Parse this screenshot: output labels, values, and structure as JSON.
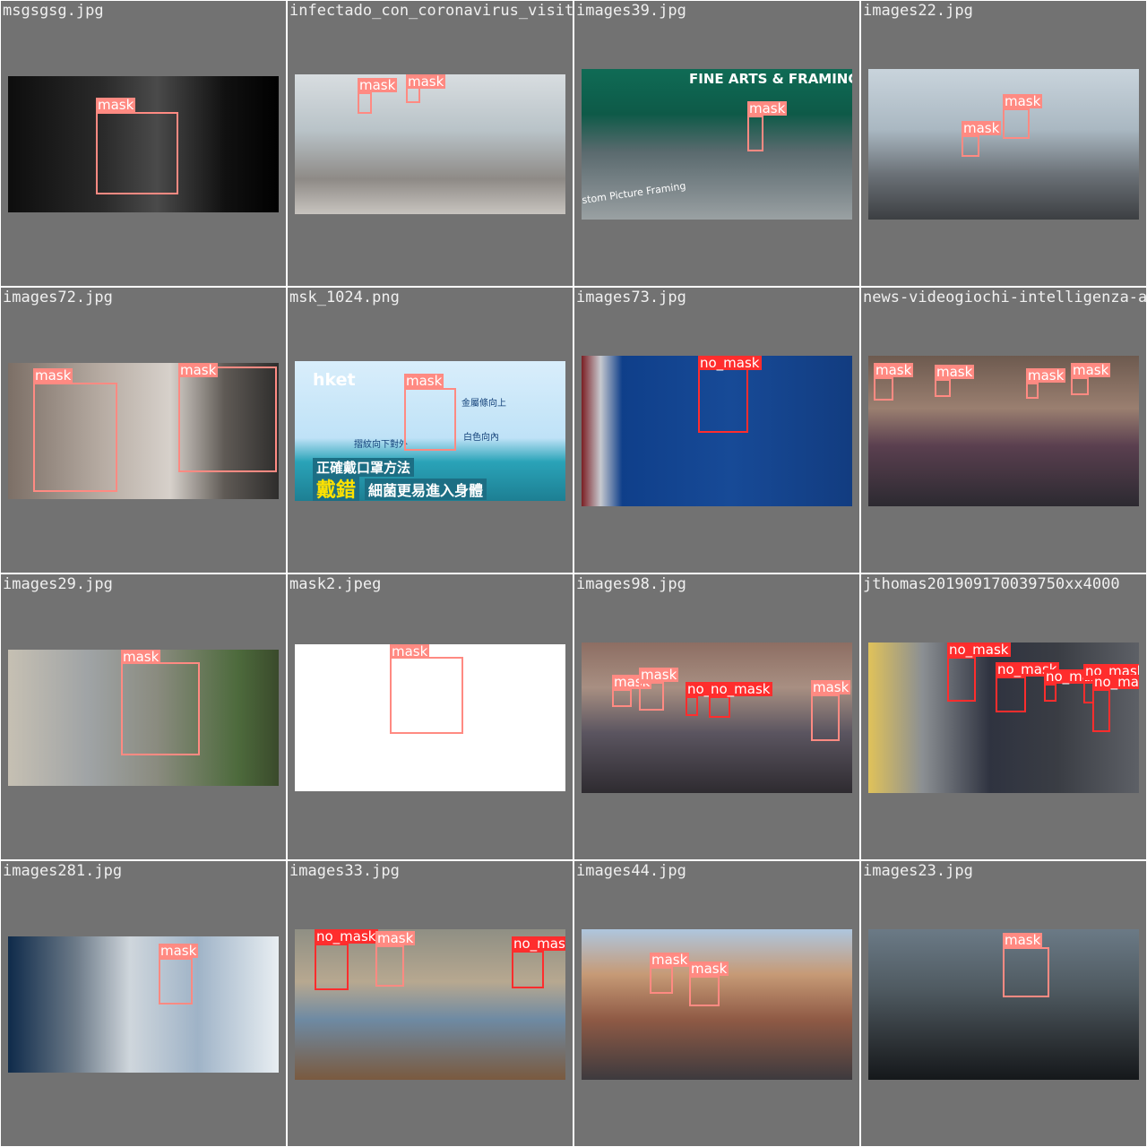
{
  "colors": {
    "mask": "#ff8a82",
    "no_mask": "#ff2d2d",
    "tile_bg": "#727272",
    "grid": "#ffffff"
  },
  "tiles": [
    {
      "title": "msgsgsg.jpg",
      "scene_texts": [],
      "detections": [
        {
          "label": "mask",
          "class": "mask"
        }
      ]
    },
    {
      "title": "infectado_con_coronavirus_visito_l",
      "scene_texts": [],
      "detections": [
        {
          "label": "mask",
          "class": "mask"
        },
        {
          "label": "mask",
          "class": "mask"
        }
      ]
    },
    {
      "title": "images39.jpg",
      "scene_texts": [
        "FINE ARTS & FRAMING",
        "stom Picture Framing"
      ],
      "detections": [
        {
          "label": "mask",
          "class": "mask"
        }
      ]
    },
    {
      "title": "images22.jpg",
      "scene_texts": [],
      "detections": [
        {
          "label": "mask",
          "class": "mask"
        },
        {
          "label": "mask",
          "class": "mask"
        }
      ]
    },
    {
      "title": "images72.jpg",
      "scene_texts": [],
      "detections": [
        {
          "label": "mask",
          "class": "mask"
        },
        {
          "label": "mask",
          "class": "mask"
        }
      ]
    },
    {
      "title": "msk_1024.png",
      "scene_texts": [
        "hket",
        "金屬條向上",
        "白色向內",
        "摺紋向下對外",
        "正確戴口罩方法",
        "戴錯",
        "細菌更易進入身體"
      ],
      "detections": [
        {
          "label": "mask",
          "class": "mask"
        }
      ]
    },
    {
      "title": "images73.jpg",
      "scene_texts": [],
      "detections": [
        {
          "label": "no_mask",
          "class": "no_mask"
        }
      ]
    },
    {
      "title": "news-videogiochi-intelligenza-art",
      "scene_texts": [],
      "detections": [
        {
          "label": "mask",
          "class": "mask"
        },
        {
          "label": "mask",
          "class": "mask"
        },
        {
          "label": "mask",
          "class": "mask"
        },
        {
          "label": "mask",
          "class": "mask"
        }
      ]
    },
    {
      "title": "images29.jpg",
      "scene_texts": [],
      "detections": [
        {
          "label": "mask",
          "class": "mask"
        }
      ]
    },
    {
      "title": "mask2.jpeg",
      "scene_texts": [],
      "detections": [
        {
          "label": "mask",
          "class": "mask"
        }
      ]
    },
    {
      "title": "images98.jpg",
      "scene_texts": [],
      "detections": [
        {
          "label": "mask",
          "class": "mask"
        },
        {
          "label": "mask",
          "class": "mask"
        },
        {
          "label": "no_mask",
          "class": "no_mask"
        },
        {
          "label": "no_mask",
          "class": "no_mask"
        },
        {
          "label": "mask",
          "class": "mask"
        }
      ]
    },
    {
      "title": "jthomas201909170039750xx4000",
      "scene_texts": [],
      "detections": [
        {
          "label": "no_mask",
          "class": "no_mask"
        },
        {
          "label": "no_mask",
          "class": "no_mask"
        },
        {
          "label": "no_mask",
          "class": "no_mask"
        },
        {
          "label": "no_mask",
          "class": "no_mask"
        },
        {
          "label": "no_mask",
          "class": "no_mask"
        }
      ]
    },
    {
      "title": "images281.jpg",
      "scene_texts": [],
      "detections": [
        {
          "label": "mask",
          "class": "mask"
        }
      ]
    },
    {
      "title": "images33.jpg",
      "scene_texts": [],
      "detections": [
        {
          "label": "no_mask",
          "class": "no_mask"
        },
        {
          "label": "mask",
          "class": "mask"
        },
        {
          "label": "no_mask",
          "class": "no_mask"
        }
      ]
    },
    {
      "title": "images44.jpg",
      "scene_texts": [],
      "detections": [
        {
          "label": "mask",
          "class": "mask"
        },
        {
          "label": "mask",
          "class": "mask"
        }
      ]
    },
    {
      "title": "images23.jpg",
      "scene_texts": [],
      "detections": [
        {
          "label": "mask",
          "class": "mask"
        }
      ]
    }
  ]
}
